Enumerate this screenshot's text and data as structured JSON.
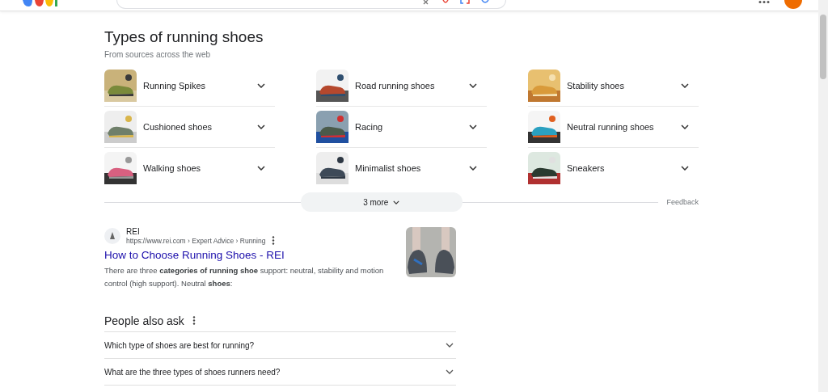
{
  "section": {
    "title": "Types of running shoes",
    "subtitle": "From sources across the web",
    "items": [
      {
        "label": "Running Spikes",
        "expanded": false
      },
      {
        "label": "Road running shoes",
        "expanded": false
      },
      {
        "label": "Stability shoes",
        "expanded": false
      },
      {
        "label": "Cushioned shoes",
        "expanded": false
      },
      {
        "label": "Racing",
        "expanded": false
      },
      {
        "label": "Neutral running shoes",
        "expanded": false
      },
      {
        "label": "Walking shoes",
        "expanded": false
      },
      {
        "label": "Minimalist shoes",
        "expanded": false
      },
      {
        "label": "Sneakers",
        "expanded": false
      }
    ],
    "more_button": "3 more",
    "feedback": "Feedback"
  },
  "result": {
    "site": "REI",
    "breadcrumb": "https://www.rei.com › Expert Advice › Running",
    "title": "How to Choose Running Shoes - REI",
    "snippet": "There are three **categories of running shoe** support: neutral, stability and motion control (high support). Neutral **shoes**:"
  },
  "people_also_ask": {
    "title": "People also ask",
    "questions": [
      {
        "text": "Which type of shoes are best for running?",
        "expanded": false
      },
      {
        "text": "What are the three types of shoes runners need?",
        "expanded": false
      }
    ]
  }
}
